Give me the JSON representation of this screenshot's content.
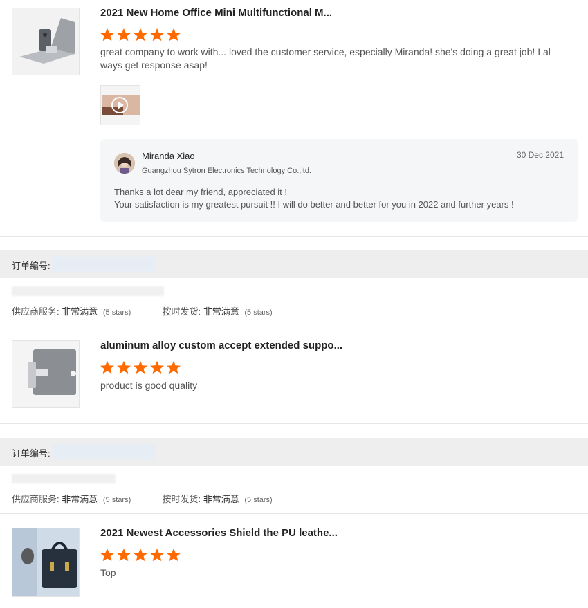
{
  "reviews": [
    {
      "title": "2021 New Home Office Mini Multifunctional M...",
      "comment": "great company to work with... loved the customer service, especially Miranda! she's doing a great job! I always get response asap!",
      "image_icon": "laptop-phone-holder-photo",
      "reply": {
        "name": "Miranda Xiao",
        "company": "Guangzhou Sytron Electronics Technology Co.,ltd.",
        "date": "30 Dec 2021",
        "line1": "Thanks a lot dear my friend, appreciated it !",
        "line2": "Your satisfaction is my greatest pursuit !! I will do better and better for you in 2022 and further years !"
      }
    },
    {
      "title": "aluminum alloy custom accept extended suppo...",
      "comment": "product is good quality",
      "image_icon": "laptop-stand-photo"
    },
    {
      "title": "2021 Newest Accessories Shield the PU leathe...",
      "comment": "Top",
      "image_icon": "leather-bag-photo"
    }
  ],
  "orders": [
    {
      "order_label": "订单编号:",
      "supplier_service_label": "供应商服务:",
      "supplier_service_value": "非常满意",
      "supplier_service_stars": "(5 stars)",
      "on_time_label": "按时发货:",
      "on_time_value": "非常满意",
      "on_time_stars": "(5 stars)"
    },
    {
      "order_label": "订单编号:",
      "supplier_service_label": "供应商服务:",
      "supplier_service_value": "非常满意",
      "supplier_service_stars": "(5 stars)",
      "on_time_label": "按时发货:",
      "on_time_value": "非常满意",
      "on_time_stars": "(5 stars)"
    }
  ],
  "ratings": [
    5,
    5,
    5
  ],
  "colors": {
    "star": "#ff6a00",
    "order_bar": "#eeeeee",
    "reply_bg": "#f5f6f8"
  }
}
